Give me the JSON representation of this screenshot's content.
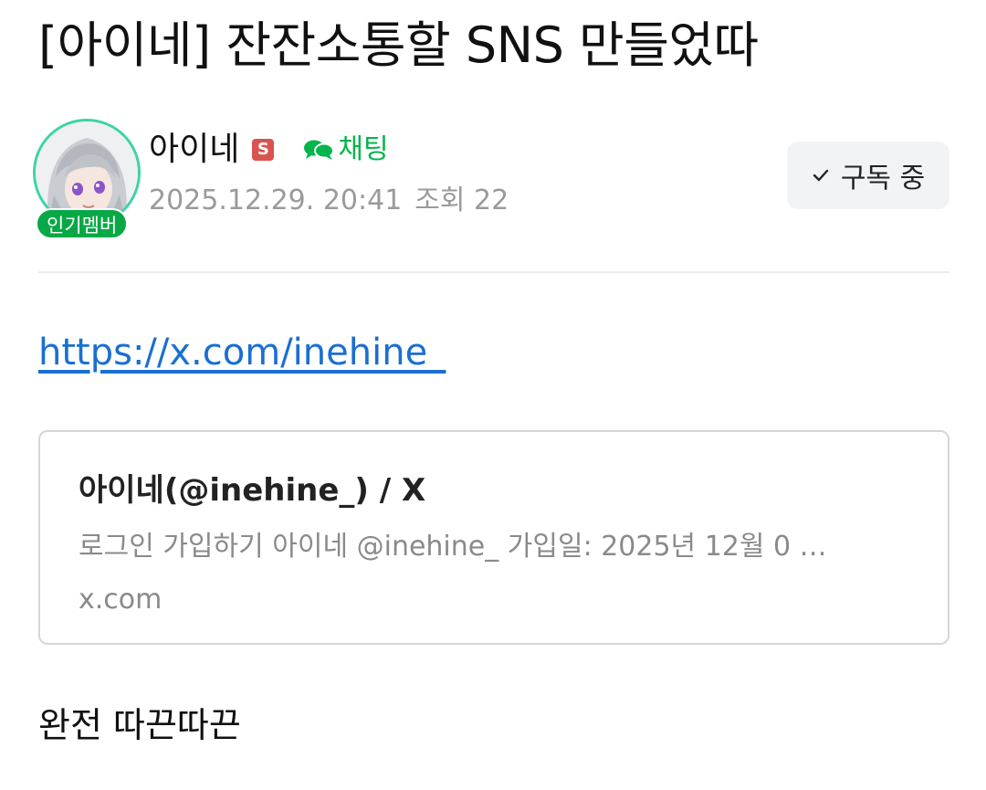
{
  "post": {
    "title": "[아이네] 잔잔소통할 SNS 만들었따",
    "body_text": "완전 따끈따끈",
    "link": "https://x.com/inehine_"
  },
  "author": {
    "name": "아이네",
    "staff_badge": "S",
    "popular_badge": "인기멤버",
    "chat_label": "채팅"
  },
  "meta": {
    "date": "2025.12.29. 20:41",
    "views": "조회 22"
  },
  "subscribe": {
    "label": "구독 중"
  },
  "og_card": {
    "title": "아이네(@inehine_) / X",
    "description": "로그인 가입하기 아이네 @inehine_ 가입일: 2025년 12월 0 …",
    "domain": "x.com"
  },
  "colors": {
    "link": "#1a6fd1",
    "chat": "#03b54a",
    "popular_badge_bg": "#09a846",
    "avatar_ring": "#3fd3a5",
    "staff_badge_bg": "#d9534f",
    "meta_text": "#9a9a9a"
  },
  "icons": {
    "chat": "chat-bubbles-icon",
    "subscribe": "checkmark-icon",
    "avatar": "avatar-illustration"
  }
}
